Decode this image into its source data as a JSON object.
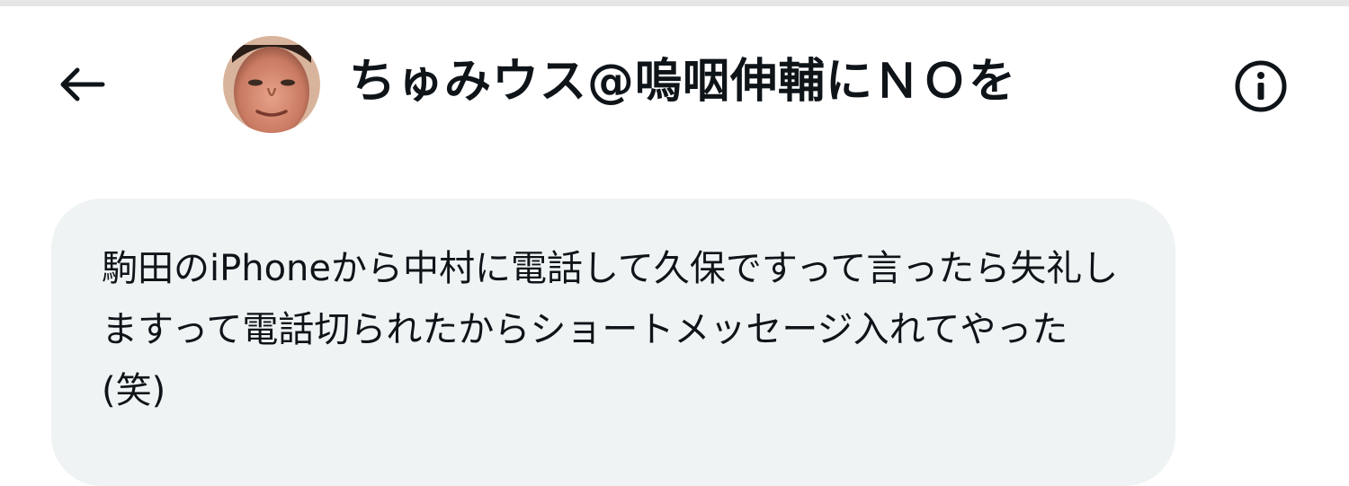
{
  "header": {
    "back_icon": "arrow-left-icon",
    "avatar_icon": "user-avatar-photo",
    "title": "ちゅみウス@嗚咽伸輔にＮＯを",
    "info_icon": "info-circle-icon"
  },
  "message": {
    "text": "駒田のiPhoneから中村に電話して久保ですって言ったら失礼しますって電話切られたからショートメッセージ入れてやった(笑)"
  },
  "colors": {
    "bubble_background": "#eff3f4",
    "text": "#0f1419",
    "top_rule": "#e6e6e6"
  }
}
